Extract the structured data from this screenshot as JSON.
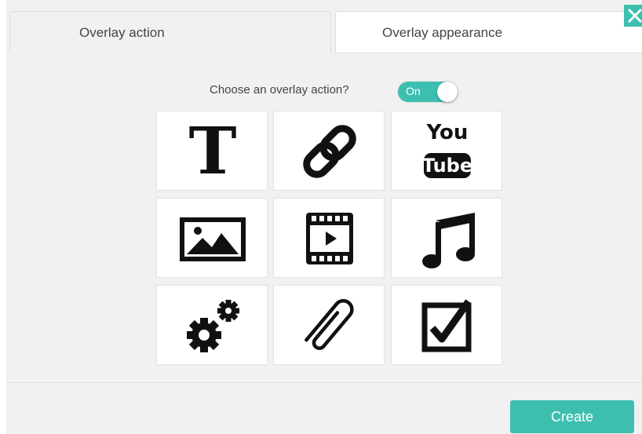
{
  "tabs": {
    "action_label": "Overlay action",
    "appearance_label": "Overlay appearance"
  },
  "toggle": {
    "question": "Choose an overlay action?",
    "state_label": "On"
  },
  "tiles": {
    "text_glyph": "T",
    "youtube_top": "You",
    "youtube_bottom": "Tube"
  },
  "footer": {
    "create_label": "Create"
  },
  "colors": {
    "accent": "#3dbfb0",
    "icon": "#111111"
  }
}
